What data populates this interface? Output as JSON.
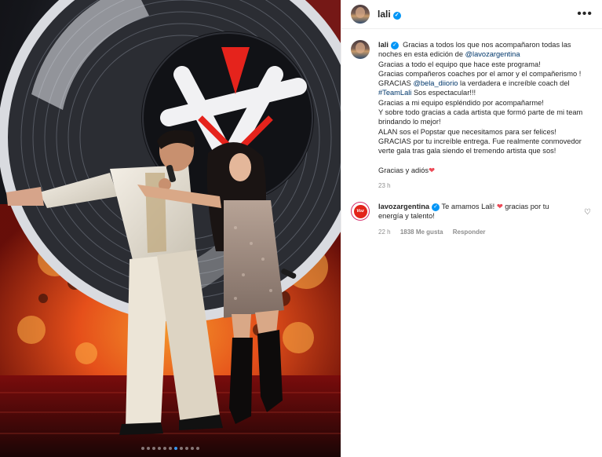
{
  "post": {
    "author": "lali",
    "more_label": "•••",
    "verified_mark": "✓",
    "carousel": {
      "count": 11,
      "active_index": 6
    }
  },
  "caption": {
    "username": "lali",
    "lines": [
      {
        "pre": "Gracias a todos los que nos acompañaron todas las noches en esta edición de ",
        "mention": "@lavozargentina",
        "post": ""
      },
      {
        "pre": "Gracias a todo el equipo que hace este programa!",
        "mention": "",
        "post": ""
      },
      {
        "pre": "Gracias compañeros coaches por el amor y el compañerismo !",
        "mention": "",
        "post": ""
      },
      {
        "pre": "GRACIAS ",
        "mention": "@bela_diiorio",
        "post": " la verdadera e increíble coach del"
      },
      {
        "pre": "",
        "mention": "#TeamLali",
        "post": " Sos espectacular!!!"
      },
      {
        "pre": "Gracias a mi equipo espléndido por acompañarme!",
        "mention": "",
        "post": ""
      },
      {
        "pre": "Y sobre todo gracias a cada artista que formó parte de mi team brindando lo mejor!",
        "mention": "",
        "post": ""
      },
      {
        "pre": "ALAN sos el Popstar que necesitamos para ser felices! GRACIAS por tu increíble entrega. Fue realmente conmovedor verte gala tras gala siendo el tremendo artista que sos!",
        "mention": "",
        "post": ""
      }
    ],
    "closing": "Gracias y adiós",
    "closing_emoji": "❤",
    "time": "23 h"
  },
  "comment": {
    "username": "lavozargentina",
    "avatar_text": "Voz",
    "text_before": "Te amamos Lali! ",
    "emoji": "❤",
    "text_after": " gracias por tu energía y talento!",
    "time": "22 h",
    "likes": "1838 Me gusta",
    "reply_label": "Responder",
    "like_icon": "heart-outline-icon",
    "like_glyph": "♡"
  }
}
